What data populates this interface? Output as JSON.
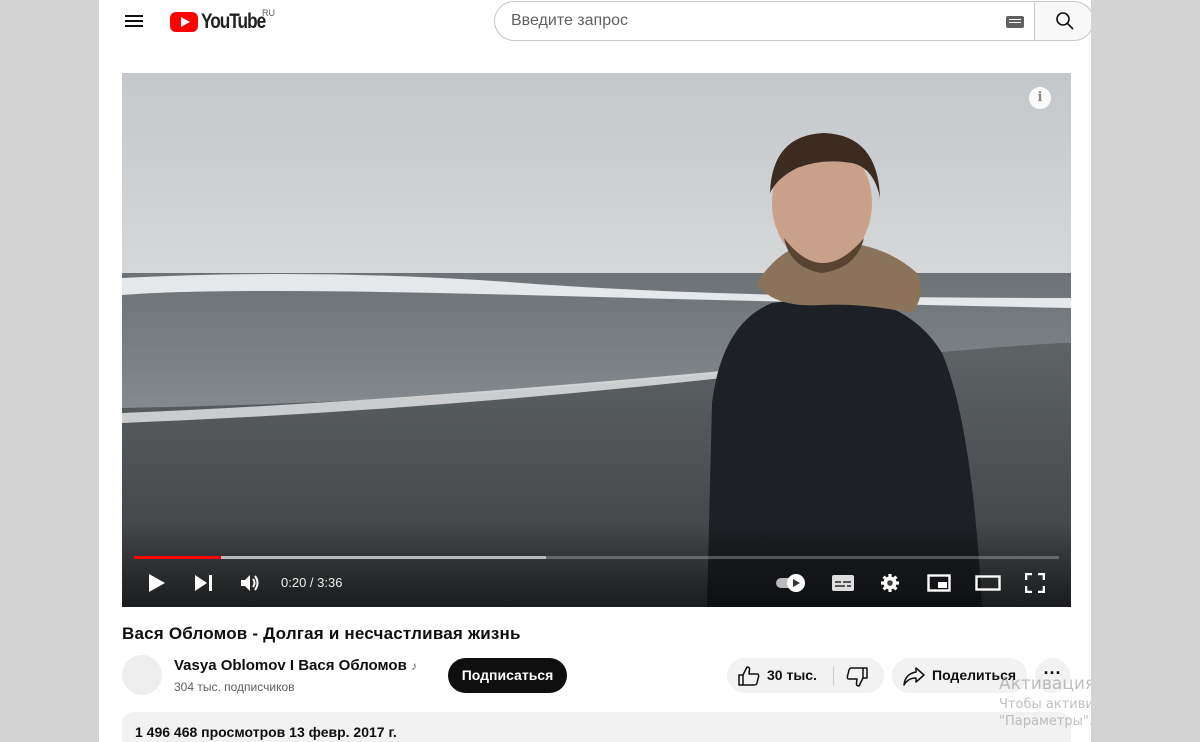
{
  "header": {
    "logo_text": "YouTube",
    "region": "RU",
    "search_placeholder": "Введите запрос"
  },
  "player": {
    "current_time": "0:20",
    "duration": "3:36",
    "time_display": "0:20 / 3:36",
    "played_fraction": 0.094,
    "buffered_fraction": 0.445,
    "info_glyph": "i"
  },
  "video": {
    "title": "Вася Обломов - Долгая и несчастливая жизнь",
    "channel": "Vasya Oblomov I Вася Обломов",
    "channel_badge_glyph": "♪",
    "subscribers": "304 тыс. подписчиков",
    "subscribe_label": "Подписаться",
    "likes": "30 тыс.",
    "share_label": "Поделиться",
    "more_label": "···",
    "views_date": "1 496 468 просмотров  13 февр. 2017 г."
  },
  "watermark": {
    "title": "Активация Windows",
    "line1": "Чтобы активировать Windo",
    "line2": "\"Параметры\"."
  },
  "colors": {
    "accent": "#ff0000",
    "subscribe_bg": "#0f0f0f",
    "chip_bg": "#f2f2f2"
  }
}
